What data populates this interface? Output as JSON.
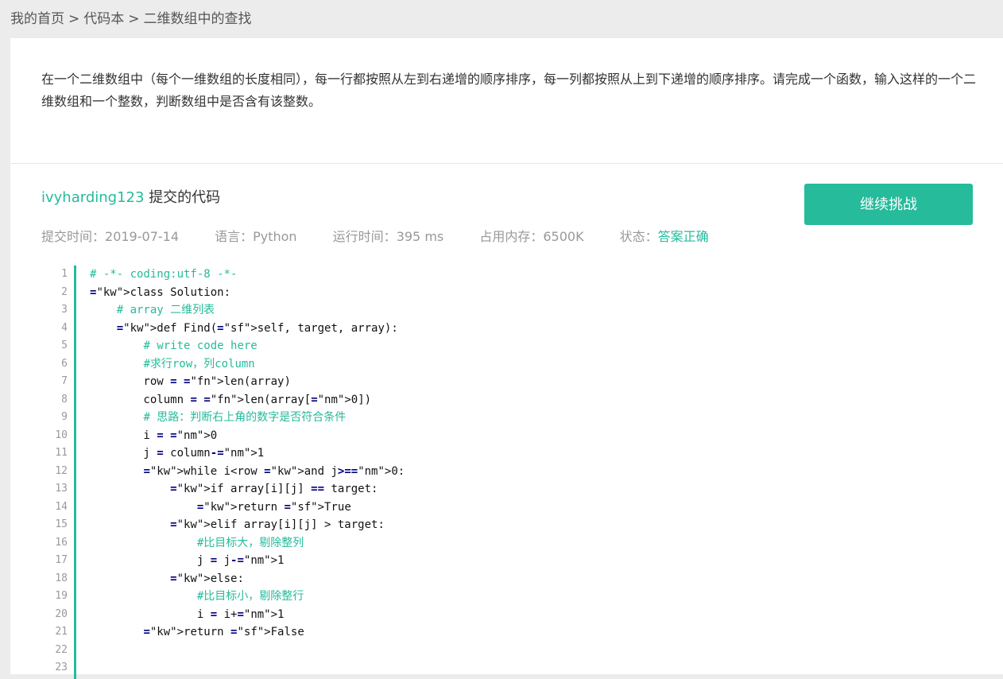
{
  "breadcrumb": {
    "home": "我的首页",
    "section": "代码本",
    "current": "二维数组中的查找",
    "separator": ">"
  },
  "problem": {
    "description": "在一个二维数组中（每个一维数组的长度相同），每一行都按照从左到右递增的顺序排序，每一列都按照从上到下递增的顺序排序。请完成一个函数，输入这样的一个二维数组和一个整数，判断数组中是否含有该整数。"
  },
  "submission": {
    "user": "ivyharding123",
    "suffix": "提交的代码",
    "continue_button": "继续挑战",
    "meta": {
      "submit_time_label": "提交时间：",
      "submit_time": "2019-07-14",
      "language_label": "语言：",
      "language": "Python",
      "runtime_label": "运行时间：",
      "runtime": "395 ms",
      "memory_label": "占用内存：",
      "memory": "6500K",
      "status_label": "状态：",
      "status": "答案正确"
    }
  },
  "code": {
    "line_numbers": [
      "1",
      "2",
      "3",
      "4",
      "5",
      "6",
      "7",
      "8",
      "9",
      "10",
      "11",
      "12",
      "13",
      "14",
      "15",
      "16",
      "17",
      "18",
      "19",
      "20",
      "21",
      "22",
      "23"
    ],
    "lines": [
      "# -*- coding:utf-8 -*-",
      "class Solution:",
      "    # array 二维列表",
      "    def Find(self, target, array):",
      "        # write code here",
      "        #求行row，列column",
      "        row = len(array)",
      "        column = len(array[0])",
      "        # 思路：判断右上角的数字是否符合条件",
      "        i = 0",
      "        j = column-1",
      "        while i<row and j>=0:",
      "            if array[i][j] == target:",
      "                return True",
      "            elif array[i][j] > target:",
      "                #比目标大，剔除整列",
      "                j = j-1",
      "            else:",
      "                #比目标小，剔除整行",
      "                i = i+1",
      "        return False",
      "",
      ""
    ]
  },
  "colors": {
    "accent": "#25bb9b",
    "keyword": "#00007f",
    "builtin": "#e0308a",
    "number": "#1aa03f"
  }
}
